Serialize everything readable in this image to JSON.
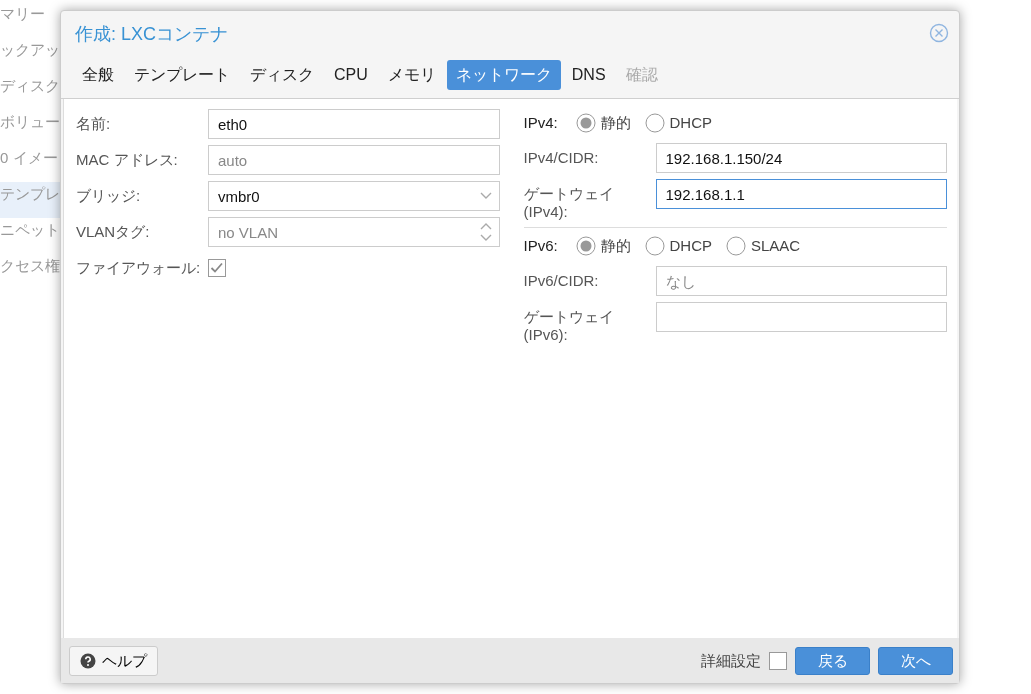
{
  "background": {
    "sidebar_items": [
      {
        "label": "マリー",
        "selected": false
      },
      {
        "label": "ックアッ",
        "selected": false
      },
      {
        "label": "ディスク",
        "selected": false
      },
      {
        "label": "ボリュー",
        "selected": false
      },
      {
        "label": "0 イメー",
        "selected": false
      },
      {
        "label": "テンプレ",
        "selected": true
      },
      {
        "label": "ニペット",
        "selected": false
      },
      {
        "label": "クセス権",
        "selected": false
      }
    ]
  },
  "dialog": {
    "title": "作成: LXCコンテナ",
    "tabs": [
      {
        "label": "全般",
        "selected": false,
        "disabled": false
      },
      {
        "label": "テンプレート",
        "selected": false,
        "disabled": false
      },
      {
        "label": "ディスク",
        "selected": false,
        "disabled": false
      },
      {
        "label": "CPU",
        "selected": false,
        "disabled": false
      },
      {
        "label": "メモリ",
        "selected": false,
        "disabled": false
      },
      {
        "label": "ネットワーク",
        "selected": true,
        "disabled": false
      },
      {
        "label": "DNS",
        "selected": false,
        "disabled": false
      },
      {
        "label": "確認",
        "selected": false,
        "disabled": true
      }
    ],
    "left_fields": [
      {
        "kind": "text",
        "label": "名前:",
        "value": "eth0"
      },
      {
        "kind": "text",
        "label": "MAC アドレス:",
        "placeholder": "auto"
      },
      {
        "kind": "combo",
        "label": "ブリッジ:",
        "value": "vmbr0"
      },
      {
        "kind": "spinner",
        "label": "VLANタグ:",
        "placeholder": "no VLAN"
      },
      {
        "kind": "checkbox",
        "label": "ファイアウォール:",
        "checked": true
      }
    ],
    "ipv4": {
      "label": "IPv4:",
      "options": [
        {
          "label": "静的",
          "selected": true
        },
        {
          "label": "DHCP",
          "selected": false
        }
      ],
      "fields": [
        {
          "label": "IPv4/CIDR:",
          "value": "192.168.1.150/24",
          "focused": false
        },
        {
          "label": "ゲートウェイ (IPv4):",
          "value": "192.168.1.1",
          "focused": true
        }
      ]
    },
    "ipv6": {
      "label": "IPv6:",
      "options": [
        {
          "label": "静的",
          "selected": true
        },
        {
          "label": "DHCP",
          "selected": false
        },
        {
          "label": "SLAAC",
          "selected": false
        }
      ],
      "fields": [
        {
          "label": "IPv6/CIDR:",
          "placeholder": "なし",
          "focused": false
        },
        {
          "label": "ゲートウェイ (IPv6):",
          "focused": false
        }
      ]
    },
    "footer": {
      "help": "ヘルプ",
      "advanced": {
        "label": "詳細設定",
        "checked": false
      },
      "buttons": [
        "戻る",
        "次へ"
      ]
    }
  }
}
